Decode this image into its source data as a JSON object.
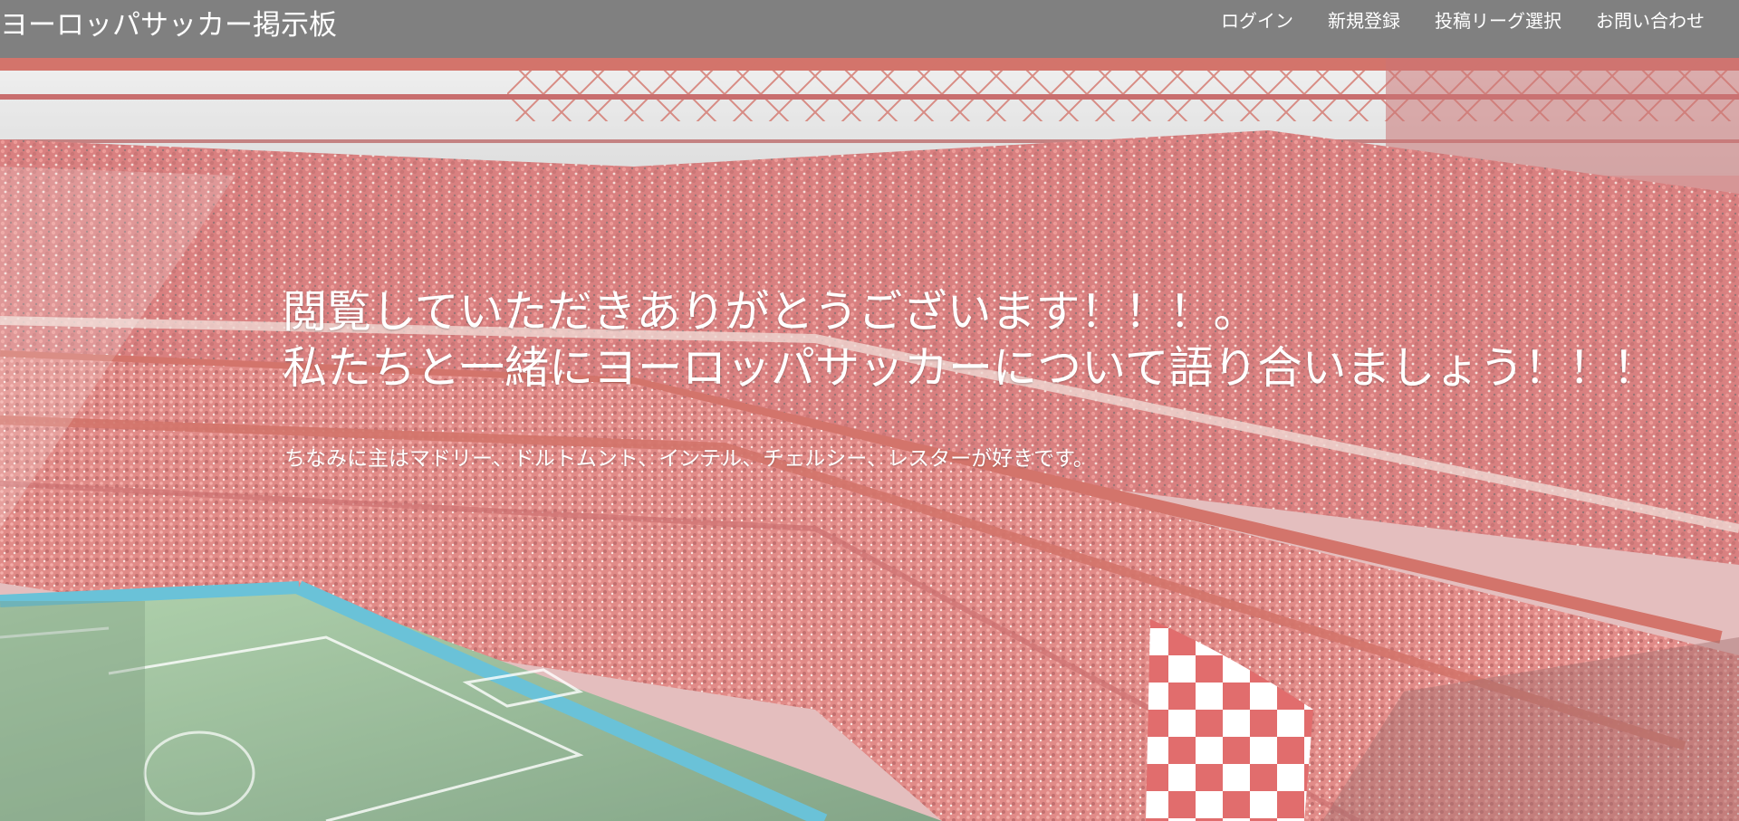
{
  "header": {
    "site_title": "ヨーロッパサッカー掲示板",
    "nav": [
      {
        "label": "ログイン"
      },
      {
        "label": "新規登録"
      },
      {
        "label": "投稿リーグ選択"
      },
      {
        "label": "お問い合わせ"
      }
    ]
  },
  "hero": {
    "heading_line1": "閲覧していただきありがとうございます！！！。",
    "heading_line2": "私たちと一緒にヨーロッパサッカーについて語り合いましょう！！！",
    "subtext": "ちなみに主はマドリー、ドルトムント、インテル、チェルシー、レスターが好きです。",
    "background_image": "stadium-crowd-photo"
  },
  "colors": {
    "header_bg": "#808080",
    "text": "#ffffff",
    "stand_red": "#d9534f",
    "pitch_green": "#6a9a6a"
  }
}
